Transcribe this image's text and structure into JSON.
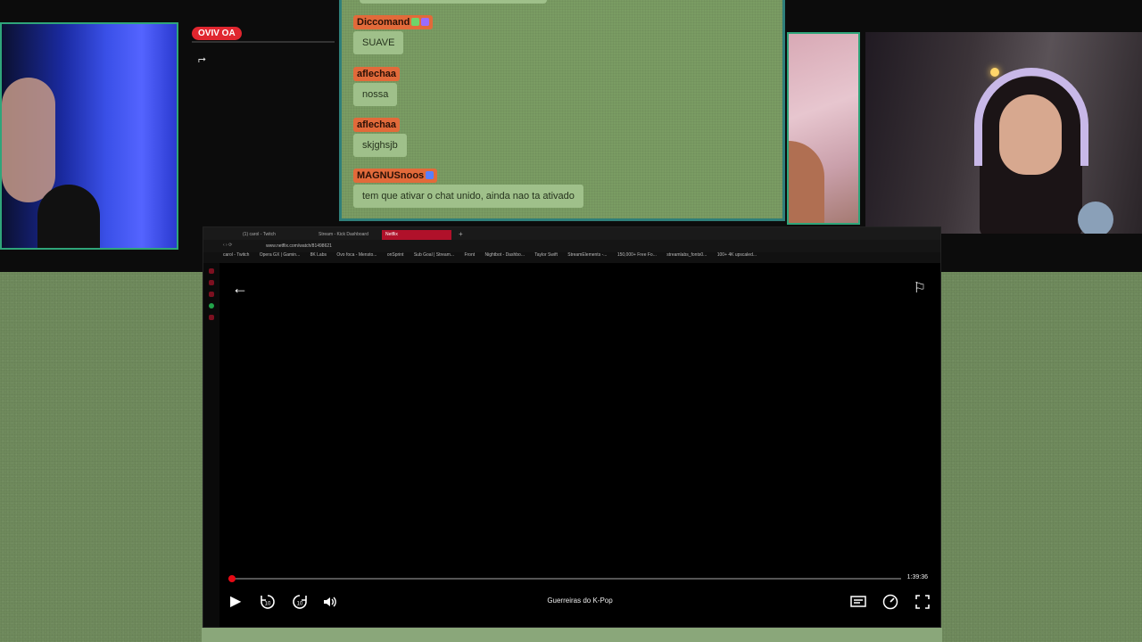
{
  "overlay": {
    "live_badge": "OVIV OA"
  },
  "chat": {
    "messages": [
      {
        "user": "Diccomand",
        "text": "SUAVE"
      },
      {
        "user": "aflechaa",
        "text": "nossa"
      },
      {
        "user": "aflechaa",
        "text": "skjghsjb"
      },
      {
        "user": "MAGNUSnoos",
        "text": "tem que ativar o chat unido, ainda nao ta ativado"
      }
    ]
  },
  "browser": {
    "tabs": [
      {
        "label": "(1) carol - Twitch"
      },
      {
        "label": "Stream - Kick Dashboard"
      },
      {
        "label": "Netflix"
      }
    ],
    "url": "www.netflix.com/watch/81498621",
    "bookmarks": [
      "carol - Twitch",
      "Opera GX | Gamin...",
      "8K Labs",
      "Ovo foca - Mensto...",
      "onSprint",
      "Sub Goal | Stream...",
      "Front",
      "Nightbot - Dashbo...",
      "Taylor Swift",
      "StreamElements -...",
      "150,000+ Free Fo...",
      "streamlabs_fonts0...",
      "100+ 4K upscaled..."
    ]
  },
  "player": {
    "title": "Guerreiras do K-Pop",
    "time_remaining": "1:39:36",
    "progress_fraction": 0.005,
    "icons": {
      "back": "back-arrow-icon",
      "report": "flag-icon",
      "play": "play-icon",
      "rewind": "rewind-10-icon",
      "forward": "forward-10-icon",
      "volume": "volume-icon",
      "subtitles": "subtitles-icon",
      "speed": "speed-icon",
      "fullscreen": "fullscreen-icon"
    }
  },
  "colors": {
    "background_green": "#6f8a5c",
    "chat_bg": "#7a9c63",
    "username_bg": "#e26a3a",
    "bubble_bg": "#9fc08a",
    "netflix_red": "#e50914",
    "border_teal": "#2f7f7a"
  }
}
